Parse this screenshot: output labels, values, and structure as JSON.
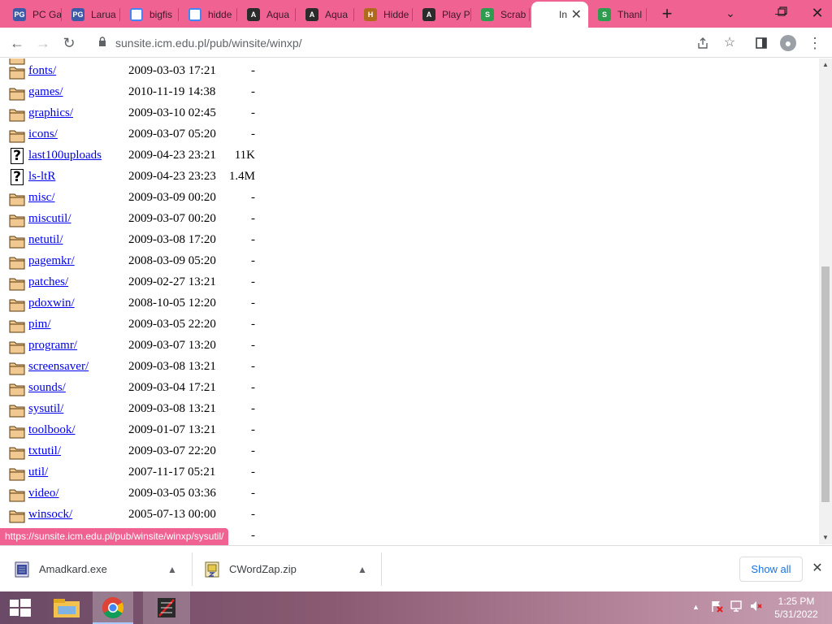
{
  "browser": {
    "tabs": [
      {
        "title": "PC Ga",
        "icon": "pcgames-favicon",
        "fav": "PG",
        "cls": "fav-pcg"
      },
      {
        "title": "Larua",
        "icon": "pcgames-favicon",
        "fav": "PG",
        "cls": "fav-pcg"
      },
      {
        "title": "bigfis",
        "icon": "google-favicon",
        "fav": "G",
        "cls": "fav-g"
      },
      {
        "title": "hidde",
        "icon": "google-favicon",
        "fav": "G",
        "cls": "fav-g"
      },
      {
        "title": "Aqua",
        "icon": "aquarium-favicon",
        "fav": "A",
        "cls": "fav-aq"
      },
      {
        "title": "Aqua",
        "icon": "aquarium-favicon",
        "fav": "A",
        "cls": "fav-aq"
      },
      {
        "title": "Hidde",
        "icon": "hidden-object-favicon",
        "fav": "H",
        "cls": "fav-hid"
      },
      {
        "title": "Play P",
        "icon": "aquarium-favicon",
        "fav": "A",
        "cls": "fav-aq"
      },
      {
        "title": "Scrab",
        "icon": "scrabble-favicon",
        "fav": "S",
        "cls": "fav-scr"
      },
      {
        "title": "In",
        "icon": "index-favicon",
        "fav": "i",
        "cls": "fav-idx",
        "active": true
      },
      {
        "title": "Thanl",
        "icon": "scrabble-favicon",
        "fav": "S",
        "cls": "fav-scr"
      }
    ],
    "url": "sunsite.icm.edu.pl/pub/winsite/winxp/",
    "status_url": "https://sunsite.icm.edu.pl/pub/winsite/winxp/sysutil/"
  },
  "listing": [
    {
      "name": "fonts/",
      "date": "2009-03-03 17:21",
      "size": "-",
      "type": "folder"
    },
    {
      "name": "games/",
      "date": "2010-11-19 14:38",
      "size": "-",
      "type": "folder"
    },
    {
      "name": "graphics/",
      "date": "2009-03-10 02:45",
      "size": "-",
      "type": "folder"
    },
    {
      "name": "icons/",
      "date": "2009-03-07 05:20",
      "size": "-",
      "type": "folder"
    },
    {
      "name": "last100uploads",
      "date": "2009-04-23 23:21",
      "size": "11K",
      "type": "file"
    },
    {
      "name": "ls-ltR",
      "date": "2009-04-23 23:23",
      "size": "1.4M",
      "type": "file"
    },
    {
      "name": "misc/",
      "date": "2009-03-09 00:20",
      "size": "-",
      "type": "folder"
    },
    {
      "name": "miscutil/",
      "date": "2009-03-07 00:20",
      "size": "-",
      "type": "folder"
    },
    {
      "name": "netutil/",
      "date": "2009-03-08 17:20",
      "size": "-",
      "type": "folder"
    },
    {
      "name": "pagemkr/",
      "date": "2008-03-09 05:20",
      "size": "-",
      "type": "folder"
    },
    {
      "name": "patches/",
      "date": "2009-02-27 13:21",
      "size": "-",
      "type": "folder"
    },
    {
      "name": "pdoxwin/",
      "date": "2008-10-05 12:20",
      "size": "-",
      "type": "folder"
    },
    {
      "name": "pim/",
      "date": "2009-03-05 22:20",
      "size": "-",
      "type": "folder"
    },
    {
      "name": "programr/",
      "date": "2009-03-07 13:20",
      "size": "-",
      "type": "folder"
    },
    {
      "name": "screensaver/",
      "date": "2009-03-08 13:21",
      "size": "-",
      "type": "folder"
    },
    {
      "name": "sounds/",
      "date": "2009-03-04 17:21",
      "size": "-",
      "type": "folder"
    },
    {
      "name": "sysutil/",
      "date": "2009-03-08 13:21",
      "size": "-",
      "type": "folder"
    },
    {
      "name": "toolbook/",
      "date": "2009-01-07 13:21",
      "size": "-",
      "type": "folder"
    },
    {
      "name": "txtutil/",
      "date": "2009-03-07 22:20",
      "size": "-",
      "type": "folder"
    },
    {
      "name": "util/",
      "date": "2007-11-17 05:21",
      "size": "-",
      "type": "folder"
    },
    {
      "name": "video/",
      "date": "2009-03-05 03:36",
      "size": "-",
      "type": "folder"
    },
    {
      "name": "winsock/",
      "date": "2005-07-13 00:00",
      "size": "-",
      "type": "folder"
    },
    {
      "name": "",
      "date": "",
      "size": "-",
      "type": "folder"
    }
  ],
  "downloads": {
    "items": [
      {
        "filename": "Amadkard.exe",
        "icon": "exe-file-icon"
      },
      {
        "filename": "CWordZap.zip",
        "icon": "zip-file-icon"
      }
    ],
    "show_all": "Show all"
  },
  "taskbar": {
    "time": "1:25 PM",
    "date": "5/31/2022"
  },
  "colors": {
    "tabstrip": "#f06292",
    "link": "#0000ee",
    "folder": "#e8b070"
  }
}
